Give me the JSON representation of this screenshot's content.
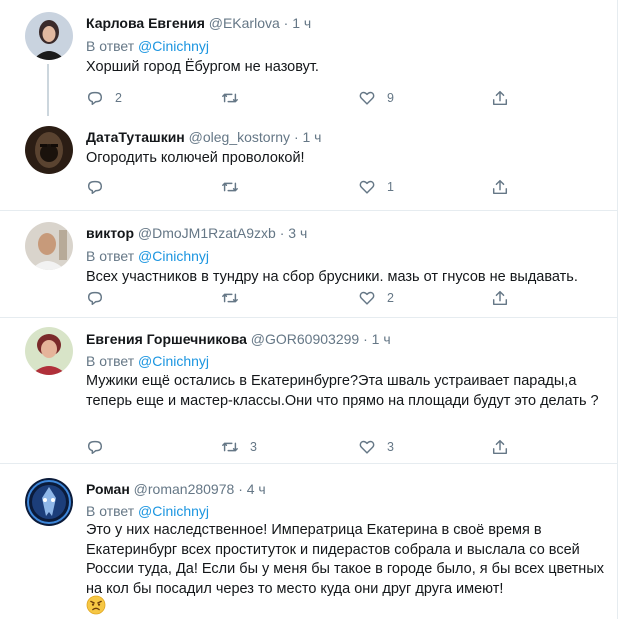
{
  "reply_prefix": "В ответ",
  "tweets": [
    {
      "name": "Карлова Евгения",
      "handle": "@EKarlova",
      "time": "1 ч",
      "reply_to": "@Cinichnyj",
      "text": "Хорший город Ёбургом не назовут.",
      "counts": {
        "reply": "2",
        "retweet": "",
        "like": "9"
      },
      "avatar_colors": [
        "#c9d3df",
        "#3a2a2a"
      ]
    },
    {
      "name": "ДатаТуташкин",
      "handle": "@oleg_kostorny",
      "time": "1 ч",
      "reply_to": "",
      "text": "Огородить колючей проволокой!",
      "counts": {
        "reply": "",
        "retweet": "",
        "like": "1"
      },
      "avatar_colors": [
        "#5a4330",
        "#2b1d14"
      ]
    },
    {
      "name": "виктор",
      "handle": "@DmoJM1RzatA9zxb",
      "time": "3 ч",
      "reply_to": "@Cinichnyj",
      "text": "Всех участников в тундру на сбор брусники. мазь от гнусов не выдавать.",
      "counts": {
        "reply": "",
        "retweet": "",
        "like": "2"
      },
      "avatar_colors": [
        "#d9d4cc",
        "#a08870"
      ]
    },
    {
      "name": "Евгения Горшечникова",
      "handle": "@GOR60903299",
      "time": "1 ч",
      "reply_to": "@Cinichnyj",
      "text": "Мужики ещё остались в Екатеринбурге?Эта шваль устраивает парады,а теперь еще и мастер-классы.Они что прямо на площади будут это делать ?",
      "counts": {
        "reply": "",
        "retweet": "3",
        "like": "3"
      },
      "avatar_colors": [
        "#d8e4c8",
        "#b0303a"
      ]
    },
    {
      "name": "Роман",
      "handle": "@roman280978",
      "time": "4 ч",
      "reply_to": "@Cinichnyj",
      "text": "Это у них наследственное! Императрица Екатерина в своё время в Екатеринбург всех проституток и пидерастов собрала и выслала со всей России туда, Да! Если бы у меня бы такое в городе было, я бы всех цветных на кол бы посадил через то место куда они друг друга имеют!",
      "counts": {
        "reply": "",
        "retweet": "",
        "like": ""
      },
      "avatar_colors": [
        "#0b1b3a",
        "#3d86d9"
      ],
      "emoji": "angry-face"
    }
  ],
  "colors": {
    "accent": "#1b95e0",
    "secondary_text": "#657786",
    "divider": "#e6ecf0",
    "thread_line": "#ccd6dd"
  }
}
